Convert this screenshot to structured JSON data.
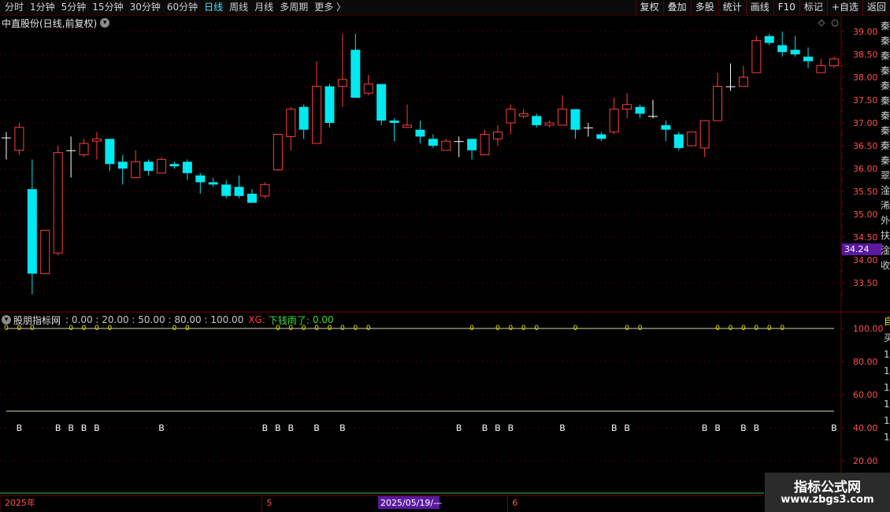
{
  "toolbar": {
    "timeframes": [
      {
        "label": "分时",
        "active": false
      },
      {
        "label": "1分钟",
        "active": false
      },
      {
        "label": "5分钟",
        "active": false
      },
      {
        "label": "15分钟",
        "active": false
      },
      {
        "label": "30分钟",
        "active": false
      },
      {
        "label": "60分钟",
        "active": false
      },
      {
        "label": "日线",
        "active": true
      },
      {
        "label": "周线",
        "active": false
      },
      {
        "label": "月线",
        "active": false
      },
      {
        "label": "多周期",
        "active": false
      },
      {
        "label": "更多 〉",
        "active": false
      }
    ],
    "tools": [
      "复权",
      "叠加",
      "多股",
      "统计",
      "画线",
      "F10",
      "标记",
      "+自选",
      "返回"
    ]
  },
  "main": {
    "title": "中直股份(日线,前复权)",
    "current_price_label": "34.24",
    "side_chars": [
      "秦",
      "秦",
      "秦",
      "秦",
      "秦",
      "秦",
      "秦",
      "秦",
      "秦",
      "秦",
      "翠",
      "淦",
      "浠",
      "外",
      "扶",
      "淦",
      "收"
    ]
  },
  "indicator": {
    "name": "股朋指标网",
    "params": ": 0.00 : 20.00 : 50.00 : 80.00 : 100.00",
    "xg_label": "XG:",
    "xg_text": "下钱雨了:",
    "xg_value": "0.00",
    "b_label": "B",
    "o_label": "0",
    "side_chars": [
      "自",
      "买",
      "1",
      "1",
      "1",
      "1",
      "1",
      "1"
    ]
  },
  "time_axis": {
    "labels": [
      {
        "text": "2025年",
        "at": 0
      },
      {
        "text": "5",
        "at": 20
      },
      {
        "text": "6",
        "at": 39
      }
    ],
    "highlight": "2025/05/19/—"
  },
  "watermark": {
    "line1": "指标公式网",
    "line2": "www.zbgs3.com"
  },
  "colors": {
    "up": "#ff3c3c",
    "down": "#00e8f0",
    "grid": "#7a0000",
    "axis_text": "#ff5050",
    "price_tag_bg": "#5a1aa0",
    "level_line": "#d8d8b0",
    "marker_yellow": "#e6e600",
    "marker_white": "#ffffff",
    "bottom_line": "#30c030",
    "time_highlight_bg": "#5a1aa0"
  },
  "chart_data": {
    "type": "candlestick",
    "y_axis": {
      "ticks": [
        33.5,
        34.0,
        34.5,
        35.0,
        35.5,
        36.0,
        36.5,
        37.0,
        37.5,
        38.0,
        38.5,
        39.0
      ],
      "range": [
        33.0,
        39.2
      ]
    },
    "indicator_axis": {
      "ticks": [
        20.0,
        40.0,
        60.0,
        80.0,
        100.0
      ],
      "range": [
        5,
        110
      ],
      "level_lines": [
        100,
        50
      ],
      "b_level": 40,
      "marker_level": 100
    },
    "candles": [
      {
        "o": 36.68,
        "h": 36.8,
        "l": 36.2,
        "c": 36.68
      },
      {
        "o": 36.4,
        "h": 37.0,
        "l": 36.3,
        "c": 36.9
      },
      {
        "o": 35.55,
        "h": 36.2,
        "l": 33.25,
        "c": 33.7
      },
      {
        "o": 33.7,
        "h": 34.65,
        "l": 33.7,
        "c": 34.65
      },
      {
        "o": 34.15,
        "h": 36.5,
        "l": 34.1,
        "c": 36.35
      },
      {
        "o": 36.4,
        "h": 36.7,
        "l": 35.8,
        "c": 36.4
      },
      {
        "o": 36.3,
        "h": 36.65,
        "l": 36.25,
        "c": 36.55
      },
      {
        "o": 36.6,
        "h": 36.8,
        "l": 36.2,
        "c": 36.65
      },
      {
        "o": 36.65,
        "h": 36.65,
        "l": 35.95,
        "c": 36.1
      },
      {
        "o": 36.15,
        "h": 36.3,
        "l": 35.65,
        "c": 36.0
      },
      {
        "o": 35.8,
        "h": 36.4,
        "l": 35.8,
        "c": 36.15
      },
      {
        "o": 36.15,
        "h": 36.2,
        "l": 35.85,
        "c": 35.95
      },
      {
        "o": 35.9,
        "h": 36.25,
        "l": 35.9,
        "c": 36.2
      },
      {
        "o": 36.1,
        "h": 36.15,
        "l": 36.0,
        "c": 36.05
      },
      {
        "o": 36.15,
        "h": 36.2,
        "l": 35.75,
        "c": 35.9
      },
      {
        "o": 35.85,
        "h": 35.9,
        "l": 35.45,
        "c": 35.7
      },
      {
        "o": 35.7,
        "h": 35.8,
        "l": 35.6,
        "c": 35.65
      },
      {
        "o": 35.65,
        "h": 35.75,
        "l": 35.35,
        "c": 35.4
      },
      {
        "o": 35.6,
        "h": 35.85,
        "l": 35.35,
        "c": 35.4
      },
      {
        "o": 35.45,
        "h": 35.55,
        "l": 35.25,
        "c": 35.25
      },
      {
        "o": 35.4,
        "h": 35.7,
        "l": 35.35,
        "c": 35.65
      },
      {
        "o": 35.97,
        "h": 36.65,
        "l": 35.95,
        "c": 36.75
      },
      {
        "o": 36.7,
        "h": 37.35,
        "l": 36.4,
        "c": 37.3
      },
      {
        "o": 37.35,
        "h": 37.4,
        "l": 36.65,
        "c": 36.85
      },
      {
        "o": 36.55,
        "h": 38.35,
        "l": 36.55,
        "c": 37.8
      },
      {
        "o": 37.8,
        "h": 37.85,
        "l": 36.9,
        "c": 37.0
      },
      {
        "o": 37.8,
        "h": 38.95,
        "l": 37.35,
        "c": 37.95
      },
      {
        "o": 38.6,
        "h": 38.95,
        "l": 37.55,
        "c": 37.55
      },
      {
        "o": 37.65,
        "h": 38.05,
        "l": 37.6,
        "c": 37.85
      },
      {
        "o": 37.85,
        "h": 37.85,
        "l": 36.95,
        "c": 37.05
      },
      {
        "o": 37.05,
        "h": 37.1,
        "l": 36.6,
        "c": 37.0
      },
      {
        "o": 36.9,
        "h": 37.4,
        "l": 36.9,
        "c": 36.95
      },
      {
        "o": 36.85,
        "h": 37.05,
        "l": 36.55,
        "c": 36.7
      },
      {
        "o": 36.65,
        "h": 36.75,
        "l": 36.45,
        "c": 36.5
      },
      {
        "o": 36.4,
        "h": 36.65,
        "l": 36.4,
        "c": 36.6
      },
      {
        "o": 36.6,
        "h": 36.7,
        "l": 36.25,
        "c": 36.6
      },
      {
        "o": 36.65,
        "h": 36.65,
        "l": 36.2,
        "c": 36.4
      },
      {
        "o": 36.3,
        "h": 36.85,
        "l": 36.3,
        "c": 36.75
      },
      {
        "o": 36.65,
        "h": 36.95,
        "l": 36.5,
        "c": 36.8
      },
      {
        "o": 37.0,
        "h": 37.4,
        "l": 36.75,
        "c": 37.3
      },
      {
        "o": 37.15,
        "h": 37.3,
        "l": 37.1,
        "c": 37.2
      },
      {
        "o": 37.15,
        "h": 37.2,
        "l": 36.9,
        "c": 36.95
      },
      {
        "o": 36.95,
        "h": 37.05,
        "l": 36.9,
        "c": 37.0
      },
      {
        "o": 36.95,
        "h": 37.6,
        "l": 36.95,
        "c": 37.3
      },
      {
        "o": 37.3,
        "h": 37.3,
        "l": 36.65,
        "c": 36.85
      },
      {
        "o": 36.9,
        "h": 37.0,
        "l": 36.7,
        "c": 36.9
      },
      {
        "o": 36.75,
        "h": 36.8,
        "l": 36.6,
        "c": 36.65
      },
      {
        "o": 36.8,
        "h": 37.55,
        "l": 36.75,
        "c": 37.3
      },
      {
        "o": 37.3,
        "h": 37.65,
        "l": 37.1,
        "c": 37.4
      },
      {
        "o": 37.35,
        "h": 37.4,
        "l": 37.1,
        "c": 37.2
      },
      {
        "o": 37.15,
        "h": 37.5,
        "l": 37.1,
        "c": 37.15
      },
      {
        "o": 36.95,
        "h": 37.05,
        "l": 36.6,
        "c": 36.85
      },
      {
        "o": 36.75,
        "h": 36.8,
        "l": 36.4,
        "c": 36.45
      },
      {
        "o": 36.5,
        "h": 36.8,
        "l": 36.5,
        "c": 36.8
      },
      {
        "o": 36.45,
        "h": 37.05,
        "l": 36.25,
        "c": 37.05
      },
      {
        "o": 37.05,
        "h": 38.1,
        "l": 37.05,
        "c": 37.8
      },
      {
        "o": 37.8,
        "h": 38.3,
        "l": 37.7,
        "c": 37.8
      },
      {
        "o": 37.8,
        "h": 38.25,
        "l": 37.8,
        "c": 38.0
      },
      {
        "o": 38.1,
        "h": 38.9,
        "l": 38.1,
        "c": 38.8
      },
      {
        "o": 38.9,
        "h": 38.95,
        "l": 38.7,
        "c": 38.75
      },
      {
        "o": 38.7,
        "h": 39.0,
        "l": 38.45,
        "c": 38.55
      },
      {
        "o": 38.6,
        "h": 38.9,
        "l": 38.45,
        "c": 38.5
      },
      {
        "o": 38.45,
        "h": 38.65,
        "l": 38.2,
        "c": 38.35
      },
      {
        "o": 38.1,
        "h": 38.4,
        "l": 38.1,
        "c": 38.25
      },
      {
        "o": 38.25,
        "h": 38.45,
        "l": 38.2,
        "c": 38.4
      }
    ],
    "b_marks": [
      1,
      4,
      5,
      6,
      7,
      12,
      20,
      21,
      22,
      24,
      26,
      35,
      37,
      38,
      39,
      43,
      47,
      48,
      54,
      55,
      57,
      58,
      64
    ],
    "o_marks": [
      0,
      1,
      2,
      5,
      6,
      7,
      8,
      13,
      14,
      21,
      22,
      23,
      24,
      25,
      26,
      27,
      28,
      36,
      38,
      39,
      40,
      41,
      44,
      48,
      49,
      55,
      56,
      57,
      58,
      59,
      60
    ]
  }
}
